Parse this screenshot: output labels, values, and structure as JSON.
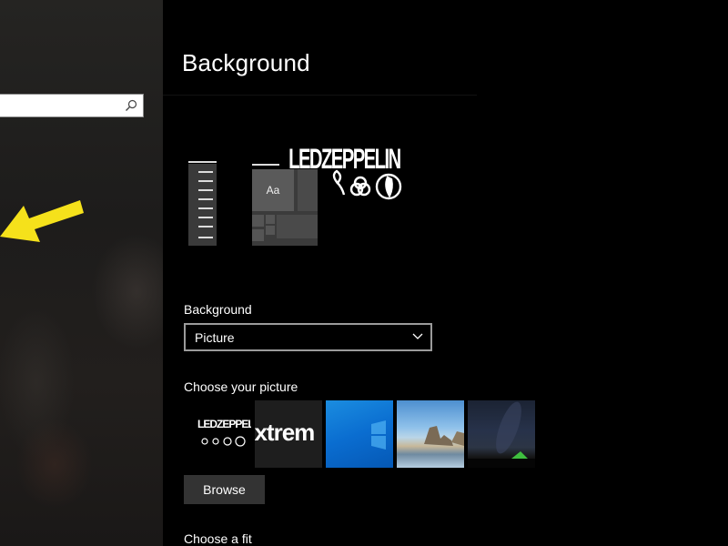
{
  "search": {
    "placeholder": "",
    "value": ""
  },
  "page": {
    "title": "Background"
  },
  "preview": {
    "sample_text": "Aa",
    "logo_text": "LEDZEPPELIN"
  },
  "background_field": {
    "label": "Background",
    "selected": "Picture"
  },
  "choose_picture": {
    "label": "Choose your picture",
    "thumbnails": [
      {
        "name": "ledzeppelin",
        "caption": "LEDZEPPELIN"
      },
      {
        "name": "brand",
        "caption": "extrem"
      },
      {
        "name": "windows-blue"
      },
      {
        "name": "beach"
      },
      {
        "name": "night-sky"
      }
    ]
  },
  "browse": {
    "label": "Browse"
  },
  "choose_fit": {
    "label": "Choose a fit"
  },
  "colors": {
    "accent_arrow": "#f5e11b",
    "window_bg": "#000000"
  },
  "icons": [
    "search-icon",
    "chevron-down-icon",
    "yellow-arrow-icon"
  ]
}
